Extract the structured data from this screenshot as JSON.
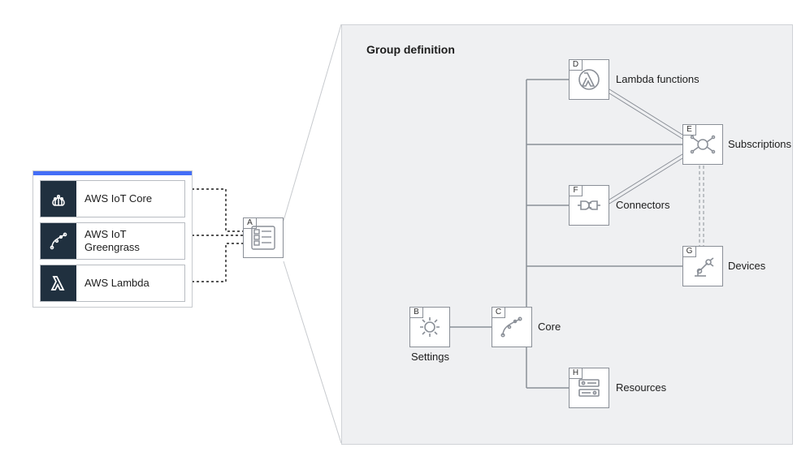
{
  "services": {
    "iot_core": {
      "label": "AWS IoT Core"
    },
    "greengrass": {
      "label": "AWS IoT Greengrass"
    },
    "lambda": {
      "label": "AWS Lambda"
    }
  },
  "group_definition_title": "Group definition",
  "nodes": {
    "A": {
      "tag": "A",
      "label": ""
    },
    "B": {
      "tag": "B",
      "label": "Settings"
    },
    "C": {
      "tag": "C",
      "label": "Core"
    },
    "D": {
      "tag": "D",
      "label": "Lambda functions"
    },
    "E": {
      "tag": "E",
      "label": "Subscriptions"
    },
    "F": {
      "tag": "F",
      "label": "Connectors"
    },
    "G": {
      "tag": "G",
      "label": "Devices"
    },
    "H": {
      "tag": "H",
      "label": "Resources"
    }
  },
  "colors": {
    "panel_accent": "#446ef7",
    "dark_icon_bg": "#20303f",
    "node_border": "#8a8f97",
    "def_bg": "#eff0f2",
    "line_gray": "#8a8f97"
  },
  "connections": {
    "dotted_from_services_to_A": [
      "iot_core",
      "greengrass",
      "lambda"
    ],
    "tree_from_C": [
      "D",
      "E",
      "F",
      "G",
      "H"
    ],
    "B_to_C": true,
    "double_lines": [
      [
        "D",
        "E"
      ],
      [
        "F",
        "E"
      ]
    ],
    "double_vertical": [
      "E",
      "G"
    ]
  }
}
